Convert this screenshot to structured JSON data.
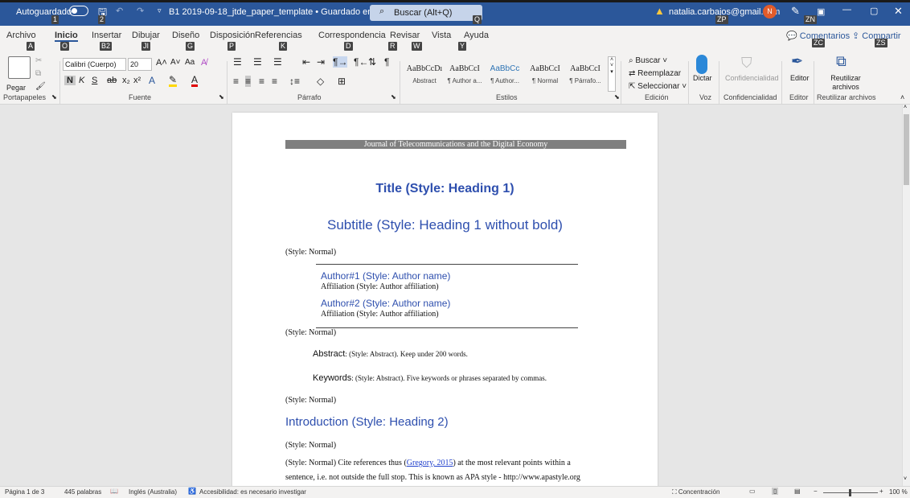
{
  "titlebar": {
    "autosave": "Autoguardado",
    "doc_title": "B1 2019-09-18_jtde_paper_template • Guardado en Este PC",
    "search_placeholder": "Buscar (Alt+Q)",
    "user": "natalia.carbajos@gmail.com",
    "avatar": "N",
    "keytips": {
      "autosave": "1",
      "save": "2",
      "search": "Q",
      "user": "ZP",
      "ideas": "ZN"
    }
  },
  "tabs": [
    {
      "label": "Archivo",
      "key": "A"
    },
    {
      "label": "Inicio",
      "key": "O"
    },
    {
      "label": "Insertar",
      "key": "B2"
    },
    {
      "label": "Dibujar",
      "key": "JI"
    },
    {
      "label": "Diseño",
      "key": "G"
    },
    {
      "label": "Disposición",
      "key": "P"
    },
    {
      "label": "Referencias",
      "key": "K"
    },
    {
      "label": "Correspondencia",
      "key": "D"
    },
    {
      "label": "Revisar",
      "key": "R"
    },
    {
      "label": "Vista",
      "key": "W"
    },
    {
      "label": "Ayuda",
      "key": "Y"
    }
  ],
  "comments_btn": {
    "label": "Comentarios",
    "key": "ZC"
  },
  "share_btn": {
    "label": "Compartir",
    "key": "ZS"
  },
  "ribbon": {
    "paste": "Pegar",
    "font_name": "Calibri (Cuerpo)",
    "font_size": "20",
    "styles": [
      {
        "preview": "AaBbCcDı",
        "name": "Abstract"
      },
      {
        "preview": "AaBbCcI",
        "name": "¶ Author a..."
      },
      {
        "preview": "AaBbCc",
        "name": "¶ Author..."
      },
      {
        "preview": "AaBbCcI",
        "name": "¶ Normal"
      },
      {
        "preview": "AaBbCcI",
        "name": "¶ Párrafo..."
      }
    ],
    "find": "Buscar",
    "replace": "Reemplazar",
    "select": "Seleccionar",
    "dictate": "Dictar",
    "confidentiality": "Confidencialidad",
    "editor": "Editor",
    "reuse": "Reutilizar archivos",
    "groups": {
      "clipboard": "Portapapeles",
      "font": "Fuente",
      "paragraph": "Párrafo",
      "styles": "Estilos",
      "editing": "Edición",
      "voice": "Voz",
      "confidentiality": "Confidencialidad",
      "editor": "Editor",
      "reuse": "Reutilizar archivos"
    }
  },
  "doc": {
    "journal_header": "Journal of Telecommunications and the Digital Economy",
    "title": "Title (Style: Heading 1)",
    "subtitle": "Subtitle (Style: Heading 1 without bold)",
    "normal1": "(Style: Normal)",
    "author1": "Author#1 (Style: Author name)",
    "aff1": "Affiliation (Style: Author affiliation)",
    "author2": "Author#2 (Style: Author name)",
    "aff2": "Affiliation (Style: Author affiliation)",
    "normal2": "(Style: Normal)",
    "abstract_label": "Abstract",
    "abstract_text": ": (Style: Abstract). Keep under 200 words.",
    "keywords_label": "Keywords",
    "keywords_text": ": (Style: Abstract). Five keywords or phrases separated by commas.",
    "normal3": "(Style: Normal)",
    "heading2": "Introduction (Style: Heading 2)",
    "normal4": "(Style: Normal)",
    "para_a": "(Style: Normal) Cite references thus (",
    "para_link": "Gregory, 2015",
    "para_b": ") at the most relevant points within a",
    "para_line2": "sentence, i.e. not outside the full stop.  This is known as APA style - http://www.apastyle.org"
  },
  "status": {
    "page": "Página 1 de 3",
    "words": "445 palabras",
    "lang": "Inglés (Australia)",
    "access": "Accesibilidad: es necesario investigar",
    "focus": "Concentración",
    "zoom": "100 %"
  },
  "colors": {
    "accent": "#2b579a",
    "heading": "#2e4fae"
  }
}
